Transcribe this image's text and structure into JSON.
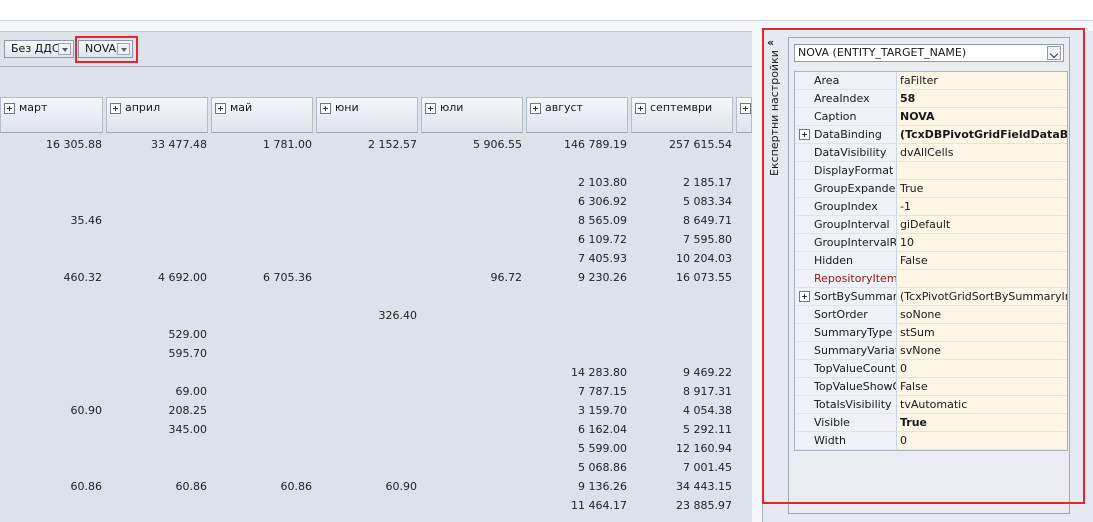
{
  "filters": [
    {
      "label": "Без ДДС"
    },
    {
      "label": "NOVA"
    }
  ],
  "columns": [
    "март",
    "април",
    "май",
    "юни",
    "юли",
    "август",
    "септември"
  ],
  "rows": [
    [
      "16 305.88",
      "33 477.48",
      "1 781.00",
      "2 152.57",
      "5 906.55",
      "146 789.19",
      "257 615.54"
    ],
    [
      "",
      "",
      "",
      "",
      "",
      "",
      ""
    ],
    [
      "",
      "",
      "",
      "",
      "",
      "2 103.80",
      "2 185.17"
    ],
    [
      "",
      "",
      "",
      "",
      "",
      "6 306.92",
      "5 083.34"
    ],
    [
      "35.46",
      "",
      "",
      "",
      "",
      "8 565.09",
      "8 649.71"
    ],
    [
      "",
      "",
      "",
      "",
      "",
      "6 109.72",
      "7 595.80"
    ],
    [
      "",
      "",
      "",
      "",
      "",
      "7 405.93",
      "10 204.03"
    ],
    [
      "460.32",
      "4 692.00",
      "6 705.36",
      "",
      "96.72",
      "9 230.26",
      "16 073.55"
    ],
    [
      "",
      "",
      "",
      "",
      "",
      "",
      ""
    ],
    [
      "",
      "",
      "",
      "326.40",
      "",
      "",
      ""
    ],
    [
      "",
      "529.00",
      "",
      "",
      "",
      "",
      ""
    ],
    [
      "",
      "595.70",
      "",
      "",
      "",
      "",
      ""
    ],
    [
      "",
      "",
      "",
      "",
      "",
      "14 283.80",
      "9 469.22"
    ],
    [
      "",
      "69.00",
      "",
      "",
      "",
      "7 787.15",
      "8 917.31"
    ],
    [
      "60.90",
      "208.25",
      "",
      "",
      "",
      "3 159.70",
      "4 054.38"
    ],
    [
      "",
      "345.00",
      "",
      "",
      "",
      "6 162.04",
      "5 292.11"
    ],
    [
      "",
      "",
      "",
      "",
      "",
      "5 599.00",
      "12 160.94"
    ],
    [
      "",
      "",
      "",
      "",
      "",
      "5 068.86",
      "7 001.45"
    ],
    [
      "60.86",
      "60.86",
      "60.86",
      "60.90",
      "",
      "9 136.26",
      "34 443.15"
    ],
    [
      "",
      "",
      "",
      "",
      "",
      "11 464.17",
      "23 885.97"
    ]
  ],
  "panel": {
    "collapse_glyph": "«",
    "title": "Експертни настройки",
    "combo_value": "NOVA (ENTITY_TARGET_NAME)",
    "properties": [
      {
        "name": "Area",
        "value": "faFilter",
        "bold": false,
        "expandable": false,
        "red": false
      },
      {
        "name": "AreaIndex",
        "value": "58",
        "bold": true,
        "expandable": false,
        "red": false
      },
      {
        "name": "Caption",
        "value": "NOVA",
        "bold": true,
        "expandable": false,
        "red": false
      },
      {
        "name": "DataBinding",
        "value": "(TcxDBPivotGridFieldDataBinding)",
        "bold": true,
        "expandable": true,
        "red": false
      },
      {
        "name": "DataVisibility",
        "value": "dvAllCells",
        "bold": false,
        "expandable": false,
        "red": false
      },
      {
        "name": "DisplayFormat",
        "value": "",
        "bold": false,
        "expandable": false,
        "red": false
      },
      {
        "name": "GroupExpanded",
        "value": "True",
        "bold": false,
        "expandable": false,
        "red": false
      },
      {
        "name": "GroupIndex",
        "value": "-1",
        "bold": false,
        "expandable": false,
        "red": false
      },
      {
        "name": "GroupInterval",
        "value": "giDefault",
        "bold": false,
        "expandable": false,
        "red": false
      },
      {
        "name": "GroupIntervalRange",
        "value": "10",
        "bold": false,
        "expandable": false,
        "red": false
      },
      {
        "name": "Hidden",
        "value": "False",
        "bold": false,
        "expandable": false,
        "red": false
      },
      {
        "name": "RepositoryItem",
        "value": "",
        "bold": false,
        "expandable": false,
        "red": true
      },
      {
        "name": "SortBySummaryInfo",
        "value": "(TcxPivotGridSortBySummaryInfo)",
        "bold": false,
        "expandable": true,
        "red": false
      },
      {
        "name": "SortOrder",
        "value": "soNone",
        "bold": false,
        "expandable": false,
        "red": false
      },
      {
        "name": "SummaryType",
        "value": "stSum",
        "bold": false,
        "expandable": false,
        "red": false
      },
      {
        "name": "SummaryVariation",
        "value": "svNone",
        "bold": false,
        "expandable": false,
        "red": false
      },
      {
        "name": "TopValueCount",
        "value": "0",
        "bold": false,
        "expandable": false,
        "red": false
      },
      {
        "name": "TopValueShowOthers",
        "value": "False",
        "bold": false,
        "expandable": false,
        "red": false
      },
      {
        "name": "TotalsVisibility",
        "value": "tvAutomatic",
        "bold": false,
        "expandable": false,
        "red": false
      },
      {
        "name": "Visible",
        "value": "True",
        "bold": true,
        "expandable": false,
        "red": false
      },
      {
        "name": "Width",
        "value": "0",
        "bold": false,
        "expandable": false,
        "red": false
      }
    ]
  }
}
